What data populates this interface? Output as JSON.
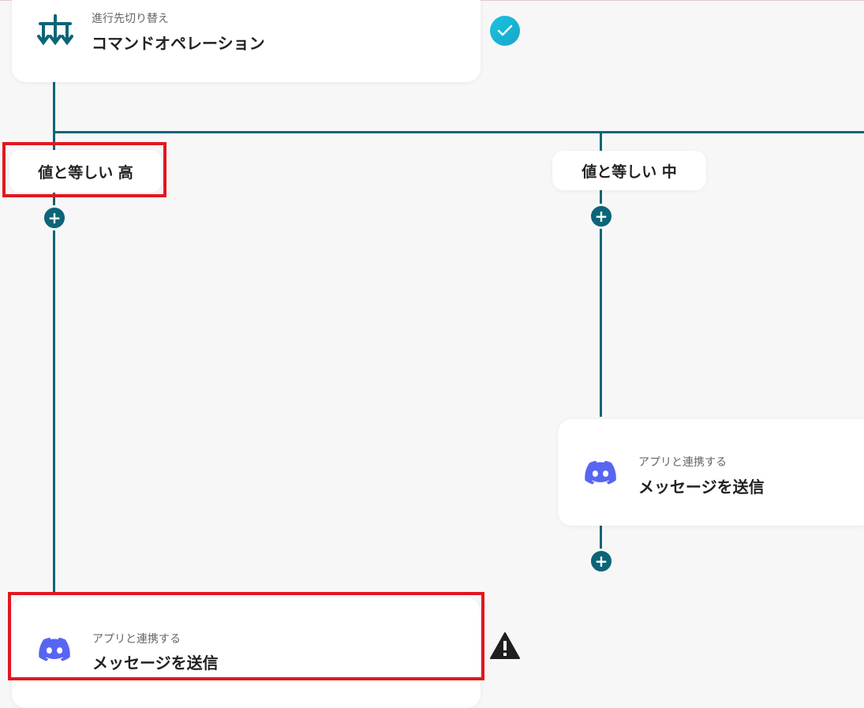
{
  "top_card": {
    "subtitle": "進行先切り替え",
    "title": "コマンドオペレーション",
    "icon": "branch-icon",
    "status": "check-icon"
  },
  "branches": [
    {
      "condition_label": "値と等しい 高",
      "add_button": "+",
      "card": {
        "subtitle": "アプリと連携する",
        "title": "メッセージを送信",
        "icon": "discord-icon",
        "status": "warning-icon"
      }
    },
    {
      "condition_label": "値と等しい 中",
      "add_button": "+",
      "card": {
        "subtitle": "アプリと連携する",
        "title": "メッセージを送信",
        "icon": "discord-icon"
      },
      "after_add_button": "+"
    }
  ],
  "colors": {
    "connector": "#0c6577",
    "highlight": "#e3161f",
    "discord": "#5865f2",
    "check": "#1bc3e0"
  }
}
